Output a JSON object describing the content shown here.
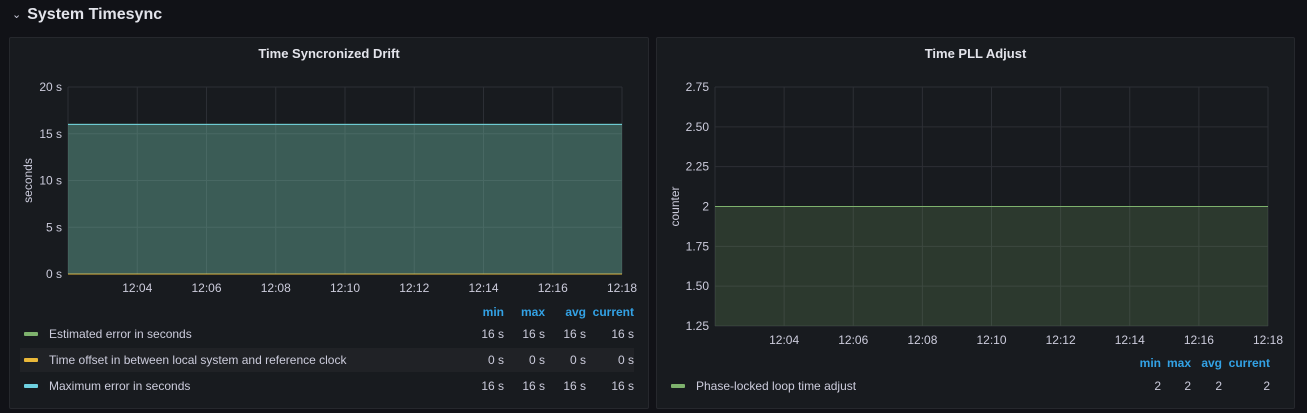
{
  "row": {
    "title": "System Timesync",
    "chevron_icon": "chevron-down-icon"
  },
  "colors": {
    "estimated_error": "#7eb26d",
    "time_offset": "#eab839",
    "maximum_error": "#6ed0e0",
    "pll": "#7eb26d",
    "legend_header": "#33a2e5"
  },
  "panels": [
    {
      "title": "Time Syncronized Drift",
      "ylabel": "seconds",
      "legend_headers": [
        "min",
        "max",
        "avg",
        "current"
      ],
      "legend": [
        {
          "name": "Estimated error in seconds",
          "min": "16 s",
          "max": "16 s",
          "avg": "16 s",
          "current": "16 s"
        },
        {
          "name": "Time offset in between local system and reference clock",
          "min": "0 s",
          "max": "0 s",
          "avg": "0 s",
          "current": "0 s"
        },
        {
          "name": "Maximum error in seconds",
          "min": "16 s",
          "max": "16 s",
          "avg": "16 s",
          "current": "16 s"
        }
      ]
    },
    {
      "title": "Time PLL Adjust",
      "ylabel": "counter",
      "legend_headers": [
        "min",
        "max",
        "avg",
        "current"
      ],
      "legend": [
        {
          "name": "Phase-locked loop time adjust",
          "min": "2",
          "max": "2",
          "avg": "2",
          "current": "2"
        }
      ]
    }
  ],
  "chart_data": [
    {
      "type": "area",
      "title": "Time Syncronized Drift",
      "ylabel": "seconds",
      "x": [
        "12:04",
        "12:06",
        "12:08",
        "12:10",
        "12:12",
        "12:14",
        "12:16",
        "12:18"
      ],
      "yticks": [
        "0 s",
        "5 s",
        "10 s",
        "15 s",
        "20 s"
      ],
      "ylim": [
        0,
        20
      ],
      "xlim": [
        "12:02",
        "12:18"
      ],
      "series": [
        {
          "name": "Estimated error in seconds",
          "color": "#7eb26d",
          "values": [
            16,
            16,
            16,
            16,
            16,
            16,
            16,
            16,
            16
          ]
        },
        {
          "name": "Time offset in between local system and reference clock",
          "color": "#eab839",
          "values": [
            0,
            0,
            0,
            0,
            0,
            0,
            0,
            0,
            0
          ]
        },
        {
          "name": "Maximum error in seconds",
          "color": "#6ed0e0",
          "values": [
            16,
            16,
            16,
            16,
            16,
            16,
            16,
            16,
            16
          ]
        }
      ],
      "grid": true,
      "legend": "bottom"
    },
    {
      "type": "area",
      "title": "Time PLL Adjust",
      "ylabel": "counter",
      "x": [
        "12:04",
        "12:06",
        "12:08",
        "12:10",
        "12:12",
        "12:14",
        "12:16",
        "12:18"
      ],
      "yticks": [
        "1.25",
        "1.50",
        "1.75",
        "2",
        "2.25",
        "2.50",
        "2.75"
      ],
      "ylim": [
        1.25,
        2.75
      ],
      "xlim": [
        "12:02",
        "12:18"
      ],
      "series": [
        {
          "name": "Phase-locked loop time adjust",
          "color": "#7eb26d",
          "values": [
            2,
            2,
            2,
            2,
            2,
            2,
            2,
            2,
            2
          ]
        }
      ],
      "grid": true,
      "legend": "bottom"
    }
  ]
}
